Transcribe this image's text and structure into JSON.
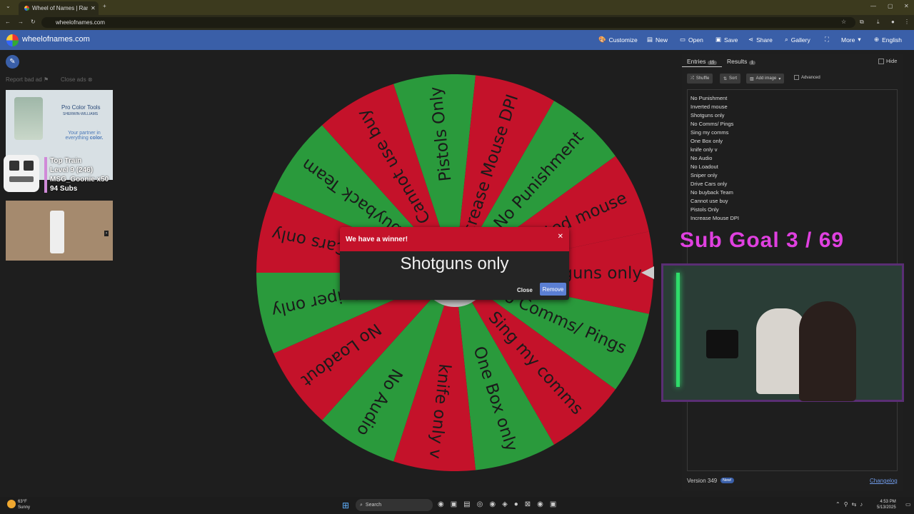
{
  "browser": {
    "tab_title": "Wheel of Names | Random",
    "url": "wheelofnames.com"
  },
  "site": {
    "name": "wheelofnames.com",
    "nav": [
      "Customize",
      "New",
      "Open",
      "Save",
      "Share",
      "Gallery",
      "More",
      "English"
    ]
  },
  "ads": {
    "report": "Report bad ad",
    "close": "Close ads",
    "ad1_title": "Pro Color Tools",
    "ad1_brand": "SHERWIN-WILLIAMS",
    "ad1_tag": "Your partner in everything",
    "ad1_tag_accent": "color."
  },
  "train": {
    "title": "Top Train",
    "level": "Level 9 (246)",
    "gifter": "MSG_Goonie x50",
    "subs": "94 Subs"
  },
  "wheel": {
    "segments": [
      "Shotguns only",
      "No Comms/ Pings",
      "Sing my comms",
      "One Box only",
      "knife only v",
      "No Audio",
      "No Loadout",
      "Sniper only",
      "Drive Cars only",
      "No buyback Team",
      "Cannot use buy",
      "Pistols Only",
      "Increase Mouse DPI",
      "No Punishment",
      "Inverted mouse"
    ],
    "colors": [
      "#c4122a",
      "#2a9a3c"
    ]
  },
  "panel": {
    "entries_tab": "Entries",
    "entries_count": "15",
    "results_tab": "Results",
    "results_count": "1",
    "hide": "Hide",
    "shuffle": "Shuffle",
    "sort": "Sort",
    "add_image": "Add image",
    "advanced": "Advanced",
    "entries": [
      "No Punishment",
      "Inverted mouse",
      "Shotguns only",
      "No Comms/ Pings",
      "Sing my comms",
      "One Box only",
      "knife only v",
      "No Audio",
      "No Loadout",
      "Sniper only",
      "Drive Cars only",
      "No buyback Team",
      "Cannot use buy",
      "Pistols Only",
      "Increase Mouse DPI"
    ],
    "version": "Version 349",
    "new_badge": "New!",
    "changelog": "Changelog"
  },
  "modal": {
    "title": "We have a winner!",
    "winner": "Shotguns only",
    "close": "Close",
    "remove": "Remove"
  },
  "stream": {
    "sub_goal": "Sub Goal  3 / 69"
  },
  "taskbar": {
    "temp": "63°F",
    "weather": "Sunny",
    "search": "Search",
    "time": "4:53 PM",
    "date": "5/13/2025"
  }
}
